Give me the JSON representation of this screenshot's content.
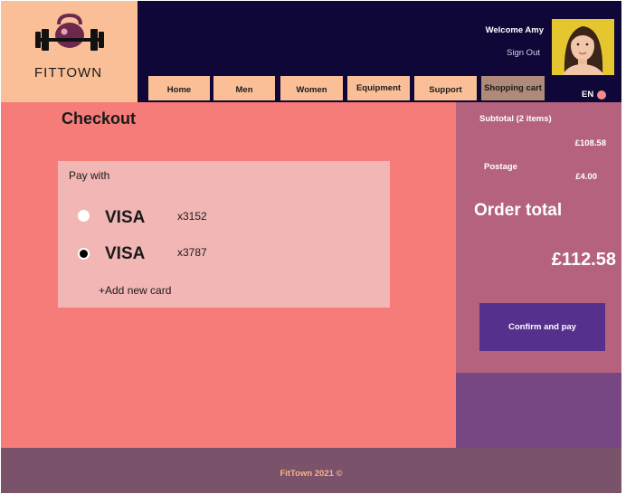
{
  "brand": {
    "name": "FITTOWN"
  },
  "header": {
    "welcome": "Welcome Amy",
    "sign_out": "Sign Out",
    "language": "EN"
  },
  "nav": {
    "items": [
      {
        "label": "Home"
      },
      {
        "label": "Men"
      },
      {
        "label": "Women"
      },
      {
        "label": "Equipment"
      },
      {
        "label": "Support"
      },
      {
        "label": "Shopping cart"
      }
    ]
  },
  "checkout": {
    "title": "Checkout",
    "pay_with": "Pay with",
    "cards": [
      {
        "brand": "VISA",
        "number": "x3152",
        "selected": false
      },
      {
        "brand": "VISA",
        "number": "x3787",
        "selected": true
      }
    ],
    "add_card": "+Add new card"
  },
  "summary": {
    "subtotal_label": "Subtotal (2 items)",
    "subtotal_value": "£108.58",
    "postage_label": "Postage",
    "postage_value": "£4.00",
    "order_total_label": "Order total",
    "order_total_value": "£112.58",
    "confirm_label": "Confirm and pay"
  },
  "footer": {
    "text": "FitTown 2021 ©"
  },
  "colors": {
    "page_bg": "#f57c78",
    "topbar": "#0f0737",
    "accent_peach": "#fbbf98",
    "summary_bg": "#b5627f",
    "confirm_button": "#55308c",
    "footer_bg": "#7a5269"
  }
}
